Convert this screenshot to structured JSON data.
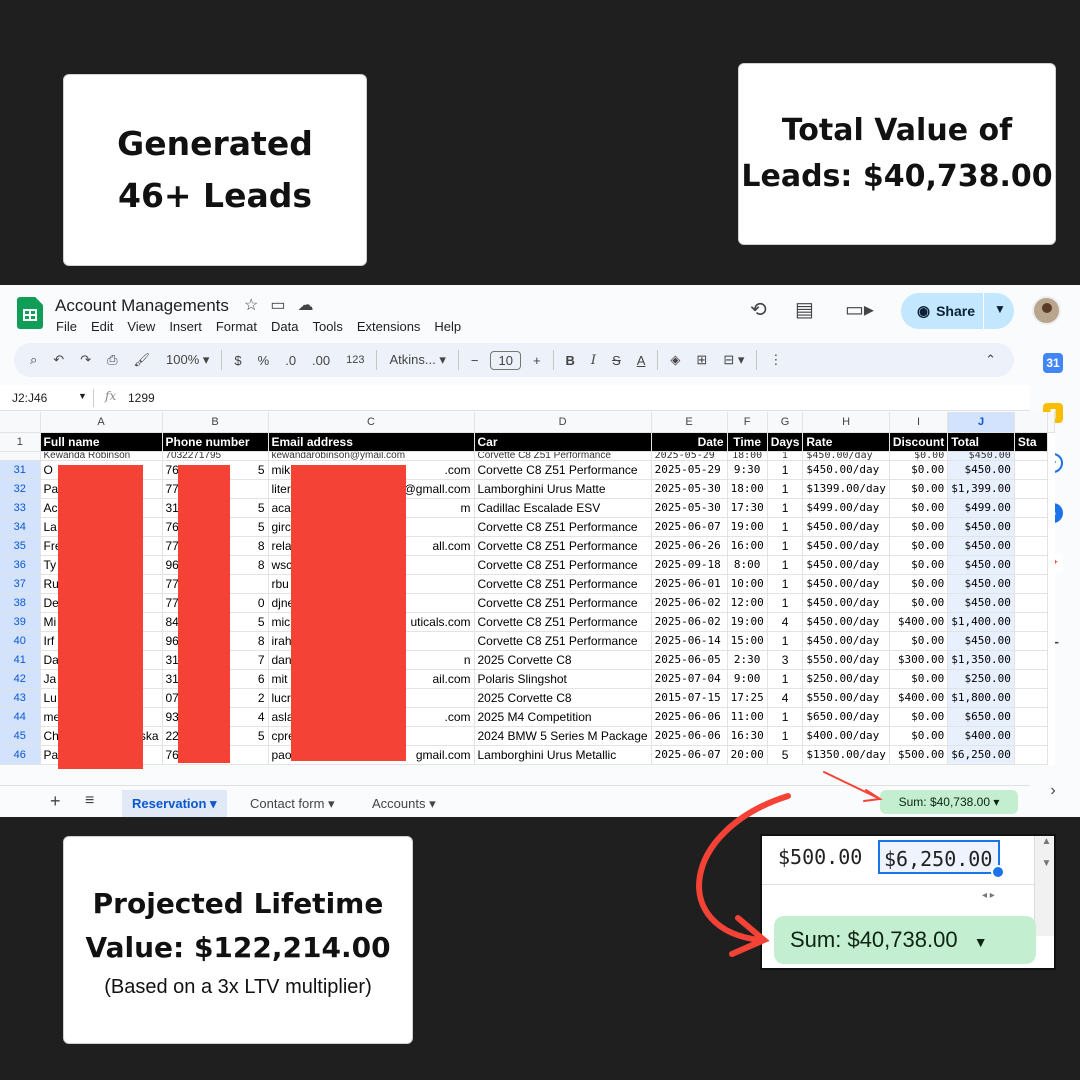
{
  "cards": {
    "leads": [
      "Generated",
      "46+ Leads"
    ],
    "total": [
      "Total Value of",
      "Leads: $40,738.00"
    ],
    "ltv": [
      "Projected Lifetime",
      "Value: $122,214.00"
    ],
    "ltv_note": "(Based on a 3x LTV multiplier)"
  },
  "app": {
    "title": "Account Managements",
    "menu": [
      "File",
      "Edit",
      "View",
      "Insert",
      "Format",
      "Data",
      "Tools",
      "Extensions",
      "Help"
    ],
    "share_label": "Share",
    "zoom": "100%",
    "currency": "$",
    "percent": "%",
    "dec_down": ".0",
    "dec_up": ".00",
    "number_format": "123",
    "font": "Atkins...",
    "font_size": "10",
    "name_box": "J2:J46",
    "formula_value": "1299"
  },
  "columns": [
    "A",
    "B",
    "C",
    "D",
    "E",
    "F",
    "G",
    "H",
    "I",
    "J"
  ],
  "header_row": {
    "num": "1",
    "cells": [
      "Full name",
      "Phone number",
      "Email address",
      "Car",
      "Date",
      "Time",
      "Days",
      "Rate",
      "Discount",
      "Total",
      "Sta"
    ]
  },
  "partial_row": [
    "Kewanda Robinson",
    "7032271795",
    "kewandarobinson@ymail.com",
    "Corvette C8 Z51 Performance",
    "2025-05-29",
    "18:00",
    "1",
    "$450.00/day",
    "$0.00",
    "$450.00"
  ],
  "rows": [
    {
      "n": "31",
      "a": "O",
      "b": "76",
      "b2": "5",
      "c": "mik",
      "c2": ".com",
      "d": "Corvette C8 Z51 Performance",
      "e": "2025-05-29",
      "f": "9:30",
      "g": "1",
      "h": "$450.00/day",
      "i": "$0.00",
      "j": "$450.00"
    },
    {
      "n": "32",
      "a": "Pa",
      "b": "77",
      "b2": "",
      "c": "liter",
      "c2": "@gmall.com",
      "d": "Lamborghini Urus Matte",
      "e": "2025-05-30",
      "f": "18:00",
      "g": "1",
      "h": "$1399.00/day",
      "i": "$0.00",
      "j": "$1,399.00"
    },
    {
      "n": "33",
      "a": "Ac",
      "b": "31",
      "b2": "5",
      "c": "aca",
      "c2": "m",
      "d": "Cadillac Escalade ESV",
      "e": "2025-05-30",
      "f": "17:30",
      "g": "1",
      "h": "$499.00/day",
      "i": "$0.00",
      "j": "$499.00"
    },
    {
      "n": "34",
      "a": "La",
      "b": "76",
      "b2": "5",
      "c": "girc",
      "c2": "",
      "d": "Corvette C8 Z51 Performance",
      "e": "2025-06-07",
      "f": "19:00",
      "g": "1",
      "h": "$450.00/day",
      "i": "$0.00",
      "j": "$450.00"
    },
    {
      "n": "35",
      "a": "Fre",
      "b": "77",
      "b2": "8",
      "c": "rela",
      "c2": "all.com",
      "d": "Corvette C8 Z51 Performance",
      "e": "2025-06-26",
      "f": "16:00",
      "g": "1",
      "h": "$450.00/day",
      "i": "$0.00",
      "j": "$450.00"
    },
    {
      "n": "36",
      "a": "Ty",
      "b": "96",
      "b2": "8",
      "c": "wsc",
      "c2": "",
      "d": "Corvette C8 Z51 Performance",
      "e": "2025-09-18",
      "f": "8:00",
      "g": "1",
      "h": "$450.00/day",
      "i": "$0.00",
      "j": "$450.00"
    },
    {
      "n": "37",
      "a": "Ru",
      "b": "77",
      "b2": "",
      "c": "rbu",
      "c2": "",
      "d": "Corvette C8 Z51 Performance",
      "e": "2025-06-01",
      "f": "10:00",
      "g": "1",
      "h": "$450.00/day",
      "i": "$0.00",
      "j": "$450.00"
    },
    {
      "n": "38",
      "a": "De",
      "b": "77",
      "b2": "0",
      "c": "djne",
      "c2": "",
      "d": "Corvette C8 Z51 Performance",
      "e": "2025-06-02",
      "f": "12:00",
      "g": "1",
      "h": "$450.00/day",
      "i": "$0.00",
      "j": "$450.00"
    },
    {
      "n": "39",
      "a": "Mi",
      "b": "84",
      "b2": "5",
      "c": "mic",
      "c2": "uticals.com",
      "d": "Corvette C8 Z51 Performance",
      "e": "2025-06-02",
      "f": "19:00",
      "g": "4",
      "h": "$450.00/day",
      "i": "$400.00",
      "j": "$1,400.00"
    },
    {
      "n": "40",
      "a": "Irf",
      "b": "96",
      "b2": "8",
      "c": "irah",
      "c2": "",
      "d": "Corvette C8 Z51 Performance",
      "e": "2025-06-14",
      "f": "15:00",
      "g": "1",
      "h": "$450.00/day",
      "i": "$0.00",
      "j": "$450.00"
    },
    {
      "n": "41",
      "a": "Da",
      "b": "31",
      "b2": "7",
      "c": "dan",
      "c2": "n",
      "d": "2025 Corvette C8",
      "e": "2025-06-05",
      "f": "2:30",
      "g": "3",
      "h": "$550.00/day",
      "i": "$300.00",
      "j": "$1,350.00"
    },
    {
      "n": "42",
      "a": "Ja",
      "b": "31",
      "b2": "6",
      "c": "mit",
      "c2": "ail.com",
      "d": "Polaris Slingshot",
      "e": "2025-07-04",
      "f": "9:00",
      "g": "1",
      "h": "$250.00/day",
      "i": "$0.00",
      "j": "$250.00"
    },
    {
      "n": "43",
      "a": "Lu",
      "b": "07",
      "b2": "2",
      "c": "lucr",
      "c2": "",
      "d": "2025 Corvette C8",
      "e": "2015-07-15",
      "f": "17:25",
      "g": "4",
      "h": "$550.00/day",
      "i": "$400.00",
      "j": "$1,800.00"
    },
    {
      "n": "44",
      "a": "me",
      "b": "93",
      "b2": "4",
      "c": "asla",
      "c2": ".com",
      "d": "2025 M4 Competition",
      "e": "2025-06-06",
      "f": "11:00",
      "g": "1",
      "h": "$650.00/day",
      "i": "$0.00",
      "j": "$650.00"
    },
    {
      "n": "45",
      "a": "Ch",
      "a2": "ska",
      "b": "22",
      "b2": "5",
      "c": "cpre",
      "c2": "",
      "d": "2024 BMW 5 Series M Package",
      "e": "2025-06-06",
      "f": "16:30",
      "g": "1",
      "h": "$400.00/day",
      "i": "$0.00",
      "j": "$400.00"
    },
    {
      "n": "46",
      "a": "Pa",
      "b": "76",
      "b2": "",
      "c": "paolo",
      "c2": "gmail.com",
      "d": "Lamborghini Urus Metallic",
      "e": "2025-06-07",
      "f": "20:00",
      "g": "5",
      "h": "$1350.00/day",
      "i": "$500.00",
      "j": "$6,250.00"
    }
  ],
  "tabs": [
    "Reservation",
    "Contact form",
    "Accounts"
  ],
  "sum_label": "Sum: $40,738.00",
  "zoom_inset": {
    "discount": "$500.00",
    "total": "$6,250.00",
    "sum": "Sum: $40,738.00"
  },
  "colors": {
    "accent": "#1a73e8",
    "redaction": "#f44336",
    "sum_pill": "#c4eed0",
    "arrow": "#f44336"
  }
}
